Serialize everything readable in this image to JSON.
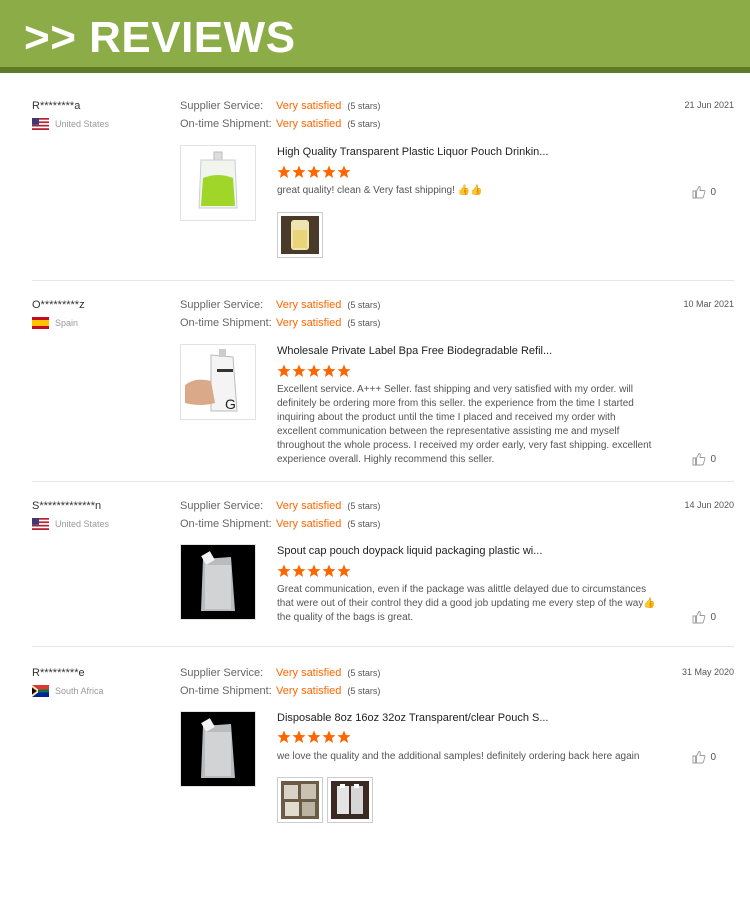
{
  "banner": {
    "title": ">> REVIEWS"
  },
  "labels": {
    "supplier_service": "Supplier Service:",
    "ontime_shipment": "On-time Shipment:"
  },
  "reviews": [
    {
      "name": "R********a",
      "country": "United States",
      "flag": "us",
      "supplier_value": "Very satisfied",
      "supplier_stars": "(5 stars)",
      "shipment_value": "Very satisfied",
      "shipment_stars": "(5 stars)",
      "date": "21 Jun 2021",
      "product_title": "High Quality Transparent Plastic Liquor Pouch Drinkin...",
      "rating": 5,
      "text": "great quality! clean & Very fast shipping! 👍👍",
      "likes": "0",
      "thumb": "green-pouch",
      "photos": [
        "juice-photo"
      ]
    },
    {
      "name": "O*********z",
      "country": "Spain",
      "flag": "es",
      "supplier_value": "Very satisfied",
      "supplier_stars": "(5 stars)",
      "shipment_value": "Very satisfied",
      "shipment_stars": "(5 stars)",
      "date": "10 Mar 2021",
      "product_title": "Wholesale Private Label Bpa Free Biodegradable Refil...",
      "rating": 5,
      "text": "Excellent service. A+++ Seller. fast shipping and very satisfied with my order.  will definitely be ordering more from this seller.  the experience from the time I started inquiring about the product until the time I placed and received my order with excellent communication between the representative assisting me and myself throughout the whole process.  I received my order early, very fast shipping. excellent experience overall. Highly recommend this seller.",
      "likes": "0",
      "thumb": "hand-pouch",
      "photos": []
    },
    {
      "name": "S*************n",
      "country": "United States",
      "flag": "us",
      "supplier_value": "Very satisfied",
      "supplier_stars": "(5 stars)",
      "shipment_value": "Very satisfied",
      "shipment_stars": "(5 stars)",
      "date": "14 Jun 2020",
      "product_title": "Spout cap pouch doypack liquid packaging plastic wi...",
      "rating": 5,
      "text": "Great communication, even if the package was alittle delayed due to circumstances that were out of their control they did a good job updating me every step of the way👍 the quality of the bags is great.",
      "likes": "0",
      "thumb": "clear-pouch",
      "photos": []
    },
    {
      "name": "R*********e",
      "country": "South Africa",
      "flag": "za",
      "supplier_value": "Very satisfied",
      "supplier_stars": "(5 stars)",
      "shipment_value": "Very satisfied",
      "shipment_stars": "(5 stars)",
      "date": "31 May 2020",
      "product_title": "Disposable 8oz 16oz 32oz Transparent/clear Pouch S...",
      "rating": 5,
      "text": "we love the quality and the additional samples! definitely ordering back here again",
      "likes": "0",
      "thumb": "clear-pouch",
      "photos": [
        "pouches-photo-1",
        "pouches-photo-2"
      ]
    }
  ],
  "colors": {
    "banner": "#8bac46",
    "banner_border": "#5d7a27",
    "accent": "#ff6600"
  }
}
